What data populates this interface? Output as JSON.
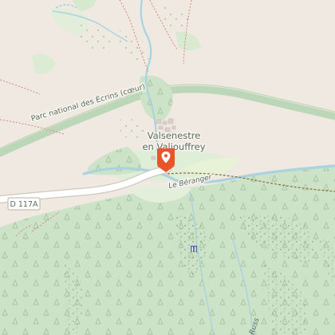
{
  "map": {
    "labels": {
      "park": "Parc national des Écrins (cœur)",
      "village_line1": "Valsenestre",
      "village_line2": "en Valjouffrey",
      "river": "Le Béranger",
      "road": "D 117A",
      "stream": "Russ"
    },
    "marker": {
      "icon": "map-pin-icon",
      "color": "#e8552a"
    },
    "colors": {
      "background": "#efe9e1",
      "forest": "#cde3c7",
      "meadow": "#dfeed7",
      "park_boundary": "#b6d5b2",
      "river": "#aad3df",
      "road": "#ffffff",
      "road_casing": "#cfc8bd",
      "track": "#d4887a",
      "tree_symbol": "#a9c7a2",
      "rock": "#8c8c8c"
    }
  }
}
